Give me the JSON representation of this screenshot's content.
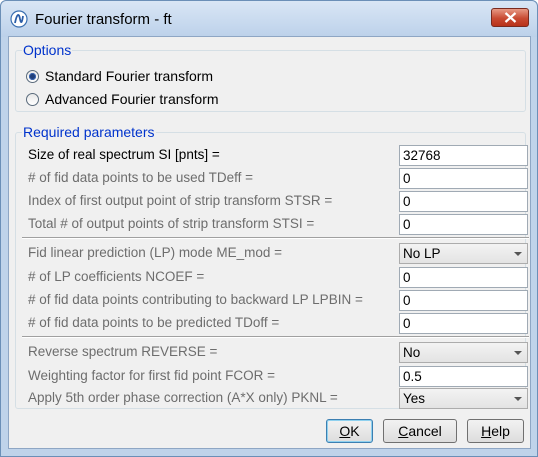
{
  "window": {
    "title": "Fourier transform - ft"
  },
  "options": {
    "legend": "Options",
    "radios": [
      {
        "label": "Standard Fourier transform",
        "checked": true
      },
      {
        "label": "Advanced Fourier transform",
        "checked": false
      }
    ]
  },
  "params": {
    "legend": "Required parameters",
    "rows": [
      {
        "label": "Size of real spectrum SI [pnts] =",
        "value": "32768",
        "kind": "input",
        "enabled": true
      },
      {
        "label": "# of fid data points to be used TDeff =",
        "value": "0",
        "kind": "input",
        "enabled": false
      },
      {
        "label": "Index of first output point of strip transform STSR =",
        "value": "0",
        "kind": "input",
        "enabled": false
      },
      {
        "label": "Total # of output points of strip transform STSI =",
        "value": "0",
        "kind": "input",
        "enabled": false
      },
      {
        "label": "Fid linear prediction (LP) mode ME_mod =",
        "value": "No LP",
        "kind": "select",
        "enabled": false
      },
      {
        "label": "# of LP coefficients NCOEF =",
        "value": "0",
        "kind": "input",
        "enabled": false
      },
      {
        "label": "# of fid data points contributing to backward LP LPBIN =",
        "value": "0",
        "kind": "input",
        "enabled": false
      },
      {
        "label": "# of fid data points to be predicted TDoff =",
        "value": "0",
        "kind": "input",
        "enabled": false
      },
      {
        "label": "Reverse spectrum REVERSE =",
        "value": "No",
        "kind": "select",
        "enabled": false
      },
      {
        "label": "Weighting factor for first fid point FCOR =",
        "value": "0.5",
        "kind": "input",
        "enabled": false
      },
      {
        "label": "Apply 5th order phase correction (A*X only) PKNL =",
        "value": "Yes",
        "kind": "select",
        "enabled": false
      }
    ]
  },
  "buttons": {
    "ok": {
      "label": "OK",
      "mnemonic": "O"
    },
    "cancel": {
      "label": "Cancel",
      "mnemonic": "C"
    },
    "help": {
      "label": "Help",
      "mnemonic": "H"
    }
  }
}
